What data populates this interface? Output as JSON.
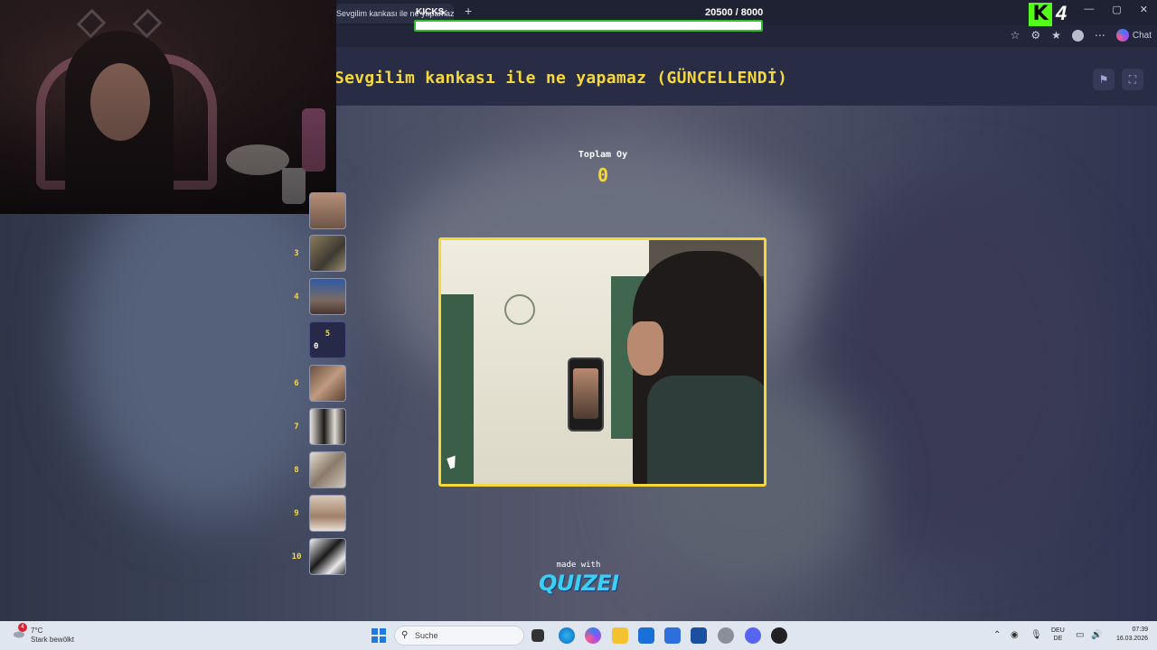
{
  "browser": {
    "tab_title": "Sevgilim kankası ile ne yapamaz (GÜNCELLENDİ)",
    "tab_close": "✕",
    "new_tab": "+",
    "minimize": "—",
    "maximize": "▢",
    "close": "✕",
    "chat_label": "Chat"
  },
  "stream_overlay": {
    "kicks_label": "KICKS",
    "counter": "20500  / 8000",
    "kick_logo": "K",
    "kick_number": "4",
    "progress_fraction": 1.0
  },
  "quiz": {
    "title": "Sevgilim kankası ile ne yapamaz (GÜNCELLENDİ)",
    "vote_label": "Toplam Oy",
    "vote_value": "0",
    "made_with": "made with",
    "brand": "QUIZEI"
  },
  "thumbnails": [
    {
      "num": "3"
    },
    {
      "num": "4"
    },
    {
      "num": "5",
      "votes": "0",
      "active": true
    },
    {
      "num": "6"
    },
    {
      "num": "7"
    },
    {
      "num": "8"
    },
    {
      "num": "9"
    },
    {
      "num": "10"
    }
  ],
  "taskbar": {
    "weather_temp": "7°C",
    "weather_desc": "Stark bewölkt",
    "weather_badge": "4",
    "search_placeholder": "Suche",
    "lang_top": "DEU",
    "lang_bottom": "DE",
    "time": "07:39",
    "date": "16.03.2026"
  },
  "colors": {
    "accent_yellow": "#f6d83c",
    "kick_green": "#53fc18",
    "header_bg": "#282c44"
  }
}
